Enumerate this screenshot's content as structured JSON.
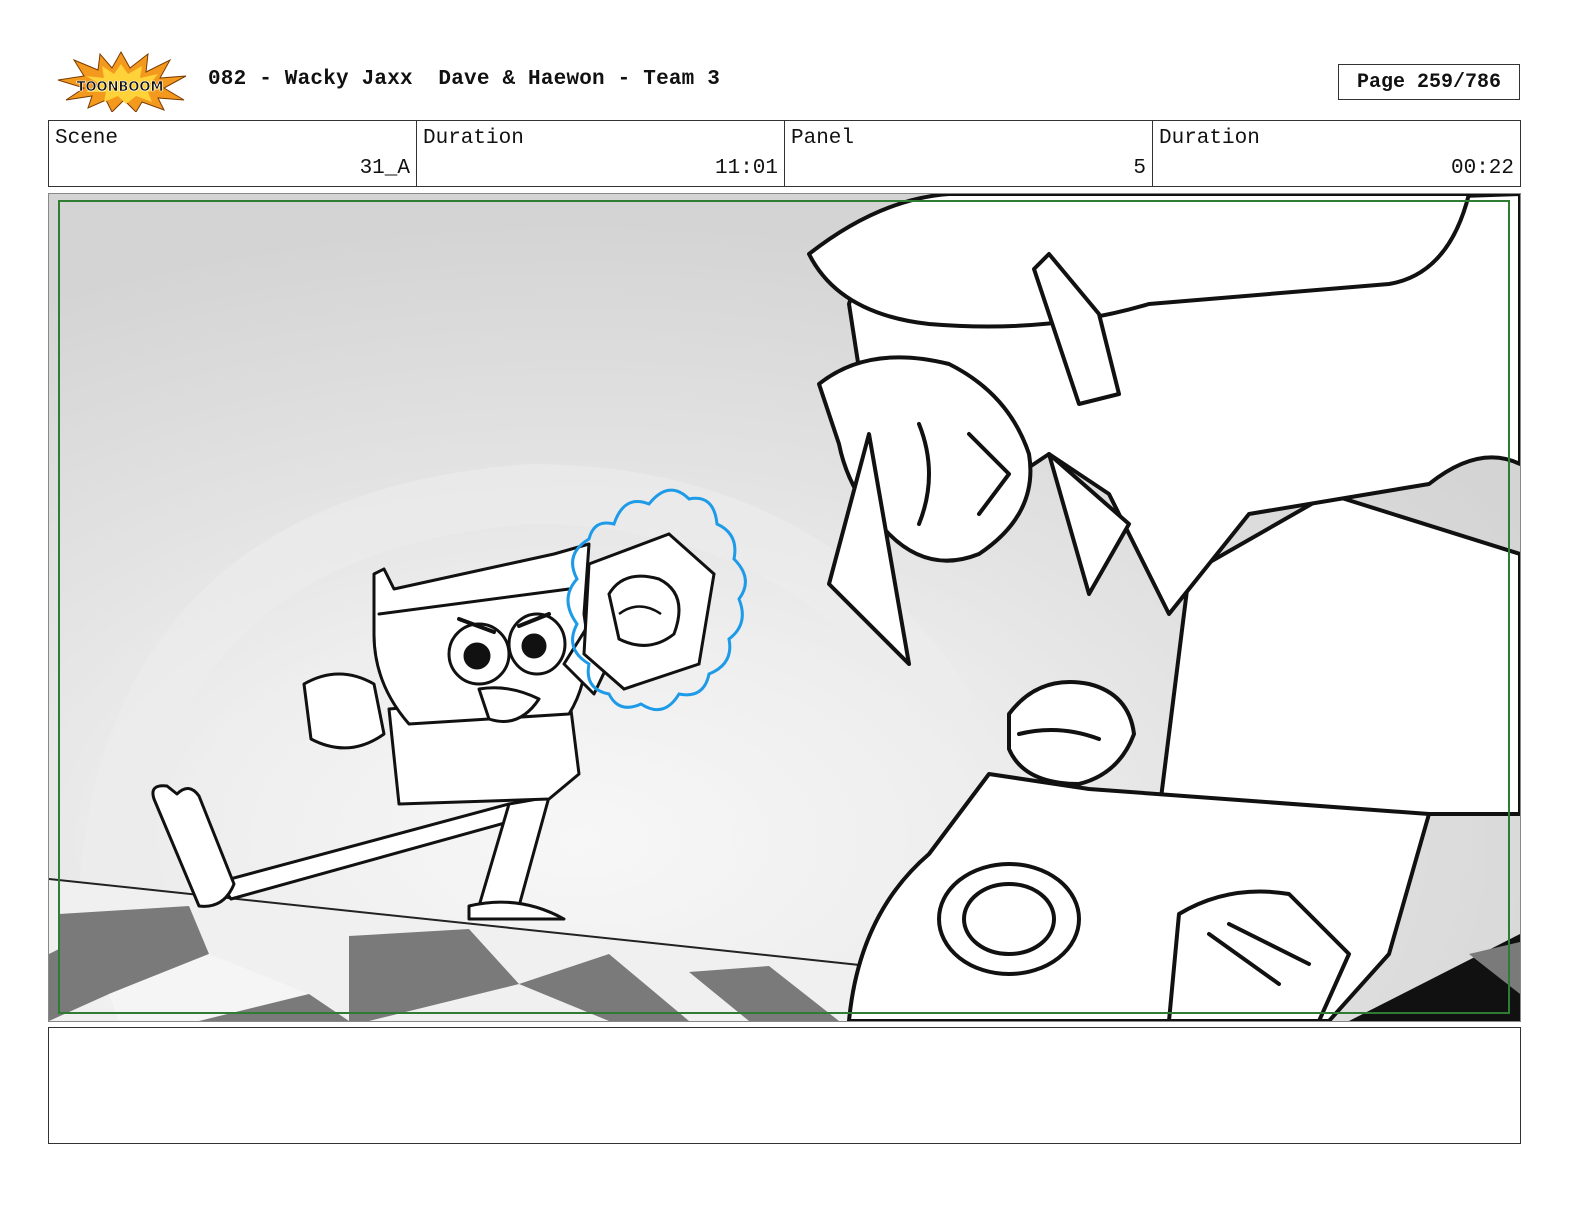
{
  "header": {
    "title": "082 - Wacky Jaxx  Dave & Haewon - Team 3",
    "page": "Page 259/786"
  },
  "logo": {
    "text": "TOONBOOM",
    "colors": {
      "burst": "#f39a1e",
      "burst_inner": "#ffd23a",
      "text": "#111111"
    }
  },
  "info": {
    "scene_label": "Scene",
    "scene_value": "31_A",
    "duration_label": "Duration",
    "duration_value": "11:01",
    "panel_label": "Panel",
    "panel_value": "5",
    "panel_duration_label": "Duration",
    "panel_duration_value": "00:22"
  },
  "panel": {
    "colors": {
      "safe_frame": "#2e7d32",
      "energy_outline": "#1e9be8",
      "floor_dark": "#7a7a7a",
      "background": "#d9d9d9"
    }
  },
  "notes": {
    "text": ""
  }
}
